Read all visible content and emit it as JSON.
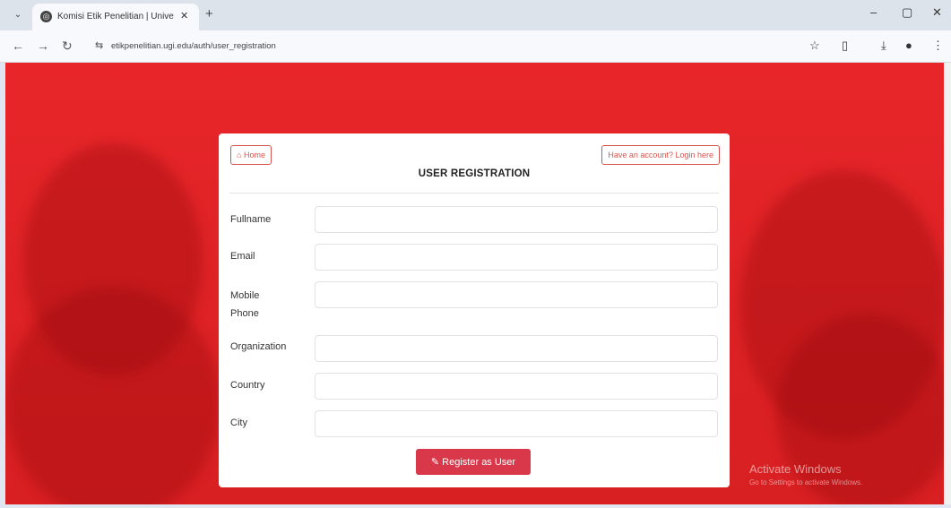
{
  "browser": {
    "tab_title": "Komisi Etik Penelitian | Univer",
    "url": "etikpenelitian.ugi.edu/auth/user_registration",
    "icons": {
      "tab_menu": "chevron-down-icon",
      "tab_close": "close-icon",
      "new_tab": "plus-icon",
      "back": "back-arrow-icon",
      "forward": "forward-arrow-icon",
      "reload": "reload-icon",
      "site_info": "site-settings-icon",
      "bookmark": "star-icon",
      "extensions": "extensions-icon",
      "download": "download-icon",
      "profile": "profile-icon",
      "menu": "more-vert-icon",
      "minimize": "minimize-icon",
      "maximize": "maximize-icon",
      "close": "close-window-icon"
    },
    "glyphs": {
      "tab_menu": "⌄",
      "tab_favicon": "◎",
      "tab_close": "✕",
      "new_tab": "+",
      "back": "←",
      "forward": "→",
      "reload": "↻",
      "site_info": "⇆",
      "bookmark": "☆",
      "extensions": "▯",
      "download": "⤓",
      "profile": "●",
      "menu": "⋮",
      "minimize": "–",
      "maximize": "▢",
      "close": "✕"
    }
  },
  "page": {
    "home_icon": "home-icon",
    "home_glyph": "⌂",
    "home_label": "Home",
    "login_label": "Have an account? Login here",
    "title": "USER REGISTRATION",
    "fields": [
      {
        "label": "Fullname",
        "value": ""
      },
      {
        "label": "Email",
        "value": ""
      },
      {
        "label": "Mobile Phone",
        "value": ""
      },
      {
        "label": "Organization",
        "value": ""
      },
      {
        "label": "Country",
        "value": ""
      },
      {
        "label": "City",
        "value": ""
      }
    ],
    "register_icon": "edit-icon",
    "register_glyph": "✎",
    "register_label": "Register as User",
    "accent_color": "#d9374a",
    "background_color": "#e02326"
  },
  "os_watermark": {
    "title": "Activate Windows",
    "subtitle": "Go to Settings to activate Windows."
  }
}
